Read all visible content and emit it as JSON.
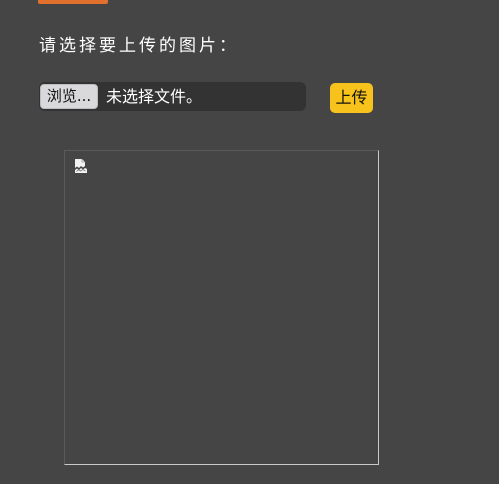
{
  "form": {
    "prompt": "请选择要上传的图片：",
    "browse_label": "浏览...",
    "file_status": "未选择文件。",
    "upload_label": "上传"
  },
  "preview": {
    "icon": "broken-image-icon"
  },
  "colors": {
    "background": "#454545",
    "accent": "#e0702b",
    "upload_button": "#f7c21b",
    "file_input_bg": "#333333"
  }
}
